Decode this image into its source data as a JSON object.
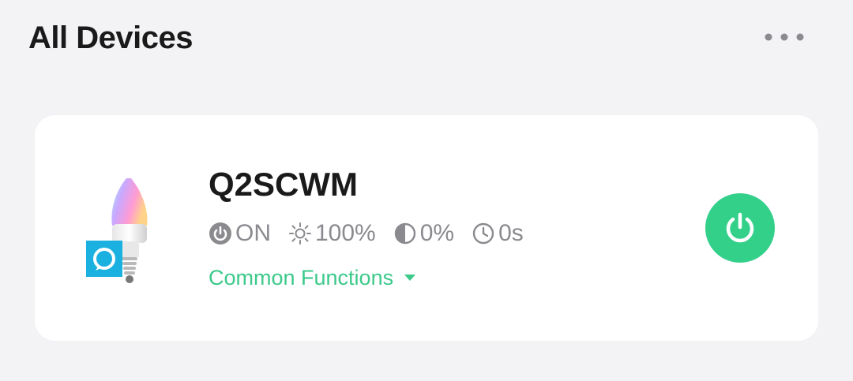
{
  "header": {
    "title": "All Devices",
    "more_icon": "more-horizontal-icon"
  },
  "device": {
    "name": "Q2SCWM",
    "image_icon": "smart-bulb-icon",
    "badge_icon": "alexa-icon",
    "status": {
      "power": {
        "icon": "power-status-icon",
        "value": "ON"
      },
      "brightness": {
        "icon": "brightness-icon",
        "value": "100%"
      },
      "contrast": {
        "icon": "contrast-icon",
        "value": "0%"
      },
      "timer": {
        "icon": "clock-icon",
        "value": "0s"
      }
    },
    "functions_label": "Common Functions",
    "power_button_icon": "power-icon"
  },
  "colors": {
    "background": "#f3f3f6",
    "card": "#ffffff",
    "accent_green": "#33d08a",
    "link_green": "#3cc98a",
    "status_gray": "#8a8a8f",
    "alexa_blue": "#1ab1e0"
  }
}
